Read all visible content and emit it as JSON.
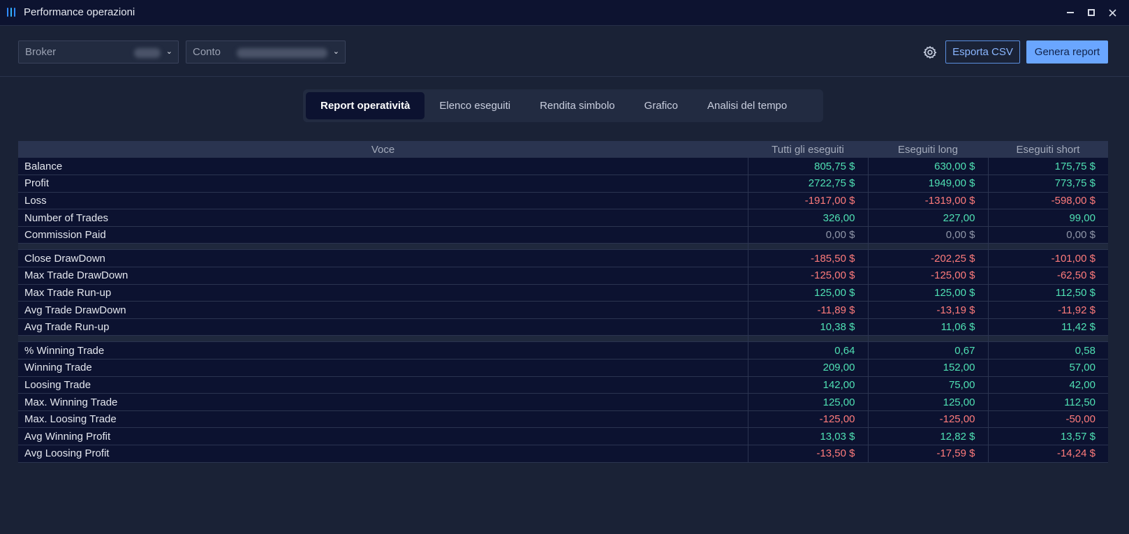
{
  "window": {
    "title": "Performance operazioni"
  },
  "toolbar": {
    "broker_label": "Broker",
    "conto_label": "Conto",
    "export_label": "Esporta CSV",
    "report_label": "Genera report"
  },
  "tabs": [
    {
      "label": "Report operatività",
      "active": true
    },
    {
      "label": "Elenco eseguiti",
      "active": false
    },
    {
      "label": "Rendita simbolo",
      "active": false
    },
    {
      "label": "Grafico",
      "active": false
    },
    {
      "label": "Analisi del tempo",
      "active": false
    }
  ],
  "table": {
    "headers": [
      "Voce",
      "Tutti gli eseguiti",
      "Eseguiti long",
      "Eseguiti short"
    ],
    "groups": [
      [
        {
          "label": "Balance",
          "values": [
            "805,75 $",
            "630,00 $",
            "175,75 $"
          ],
          "tone": [
            "pos",
            "pos",
            "pos"
          ]
        },
        {
          "label": "Profit",
          "values": [
            "2722,75 $",
            "1949,00 $",
            "773,75 $"
          ],
          "tone": [
            "pos",
            "pos",
            "pos"
          ]
        },
        {
          "label": "Loss",
          "values": [
            "-1917,00 $",
            "-1319,00 $",
            "-598,00 $"
          ],
          "tone": [
            "neg",
            "neg",
            "neg"
          ]
        },
        {
          "label": "Number of Trades",
          "values": [
            "326,00",
            "227,00",
            "99,00"
          ],
          "tone": [
            "pos",
            "pos",
            "pos"
          ]
        },
        {
          "label": "Commission Paid",
          "values": [
            "0,00 $",
            "0,00 $",
            "0,00 $"
          ],
          "tone": [
            "zero",
            "zero",
            "zero"
          ]
        }
      ],
      [
        {
          "label": "Close DrawDown",
          "values": [
            "-185,50 $",
            "-202,25 $",
            "-101,00 $"
          ],
          "tone": [
            "neg",
            "neg",
            "neg"
          ]
        },
        {
          "label": "Max Trade DrawDown",
          "values": [
            "-125,00 $",
            "-125,00 $",
            "-62,50 $"
          ],
          "tone": [
            "neg",
            "neg",
            "neg"
          ]
        },
        {
          "label": "Max Trade Run-up",
          "values": [
            "125,00 $",
            "125,00 $",
            "112,50 $"
          ],
          "tone": [
            "pos",
            "pos",
            "pos"
          ]
        },
        {
          "label": "Avg Trade DrawDown",
          "values": [
            "-11,89 $",
            "-13,19 $",
            "-11,92 $"
          ],
          "tone": [
            "neg",
            "neg",
            "neg"
          ]
        },
        {
          "label": "Avg Trade Run-up",
          "values": [
            "10,38 $",
            "11,06 $",
            "11,42 $"
          ],
          "tone": [
            "pos",
            "pos",
            "pos"
          ]
        }
      ],
      [
        {
          "label": "% Winning Trade",
          "values": [
            "0,64",
            "0,67",
            "0,58"
          ],
          "tone": [
            "pos",
            "pos",
            "pos"
          ]
        },
        {
          "label": "Winning Trade",
          "values": [
            "209,00",
            "152,00",
            "57,00"
          ],
          "tone": [
            "pos",
            "pos",
            "pos"
          ]
        },
        {
          "label": "Loosing Trade",
          "values": [
            "142,00",
            "75,00",
            "42,00"
          ],
          "tone": [
            "pos",
            "pos",
            "pos"
          ]
        },
        {
          "label": "Max. Winning Trade",
          "values": [
            "125,00",
            "125,00",
            "112,50"
          ],
          "tone": [
            "pos",
            "pos",
            "pos"
          ]
        },
        {
          "label": "Max. Loosing Trade",
          "values": [
            "-125,00",
            "-125,00",
            "-50,00"
          ],
          "tone": [
            "neg",
            "neg",
            "neg"
          ]
        },
        {
          "label": "Avg Winning Profit",
          "values": [
            "13,03 $",
            "12,82 $",
            "13,57 $"
          ],
          "tone": [
            "pos",
            "pos",
            "pos"
          ]
        },
        {
          "label": "Avg Loosing Profit",
          "values": [
            "-13,50 $",
            "-17,59 $",
            "-14,24 $"
          ],
          "tone": [
            "neg",
            "neg",
            "neg"
          ]
        }
      ]
    ]
  },
  "colors": {
    "positive": "#4fe0b3",
    "negative": "#ff7b7b",
    "neutral": "#8f96a8",
    "accent": "#6aa6ff"
  }
}
